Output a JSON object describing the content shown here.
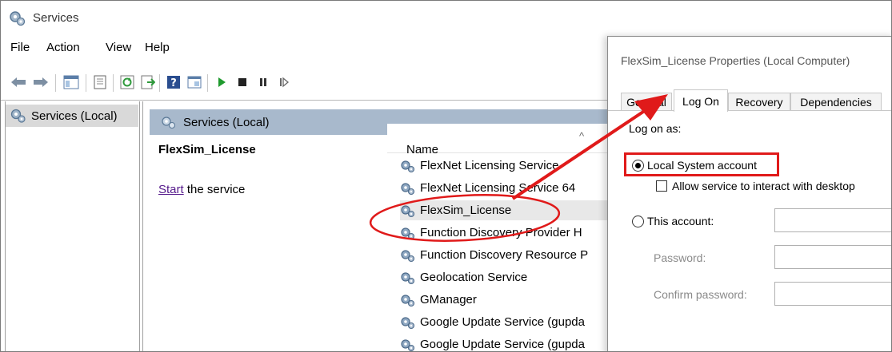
{
  "window": {
    "title": "Services",
    "icon": "gear-icon"
  },
  "menu": {
    "items": [
      "File",
      "Action",
      "View",
      "Help"
    ]
  },
  "toolbar": {
    "icons": [
      "back-arrow-icon",
      "forward-arrow-icon",
      "show-console-tree-icon",
      "properties-icon",
      "refresh-icon",
      "export-list-icon",
      "help-icon",
      "view-icon",
      "start-icon",
      "stop-icon",
      "pause-icon",
      "resume-icon"
    ]
  },
  "tree": {
    "items": [
      {
        "label": "Services (Local)"
      }
    ]
  },
  "main": {
    "header": "Services (Local)",
    "selected_service": "FlexSim_License",
    "action_link": "Start",
    "action_text": " the service",
    "list": {
      "column": "Name",
      "rows": [
        {
          "name": "FlexNet Licensing Service"
        },
        {
          "name": "FlexNet Licensing Service 64"
        },
        {
          "name": "FlexSim_License",
          "selected": true
        },
        {
          "name": "Function Discovery Provider H"
        },
        {
          "name": "Function Discovery Resource P"
        },
        {
          "name": "Geolocation Service"
        },
        {
          "name": "GManager"
        },
        {
          "name": "Google Update Service (gupda"
        },
        {
          "name": "Google Update Service (gupda"
        }
      ]
    }
  },
  "dialog": {
    "title": "FlexSim_License Properties (Local Computer)",
    "tabs": [
      "General",
      "Log On",
      "Recovery",
      "Dependencies"
    ],
    "active_tab": "Log On",
    "logon_as": "Log on as:",
    "local_system": "Local System account",
    "allow_interact": "Allow service to interact with desktop",
    "this_account": "This account:",
    "password": "Password:",
    "confirm_password": "Confirm password:",
    "local_system_selected": true
  },
  "annotation_color": "#e01a1a"
}
